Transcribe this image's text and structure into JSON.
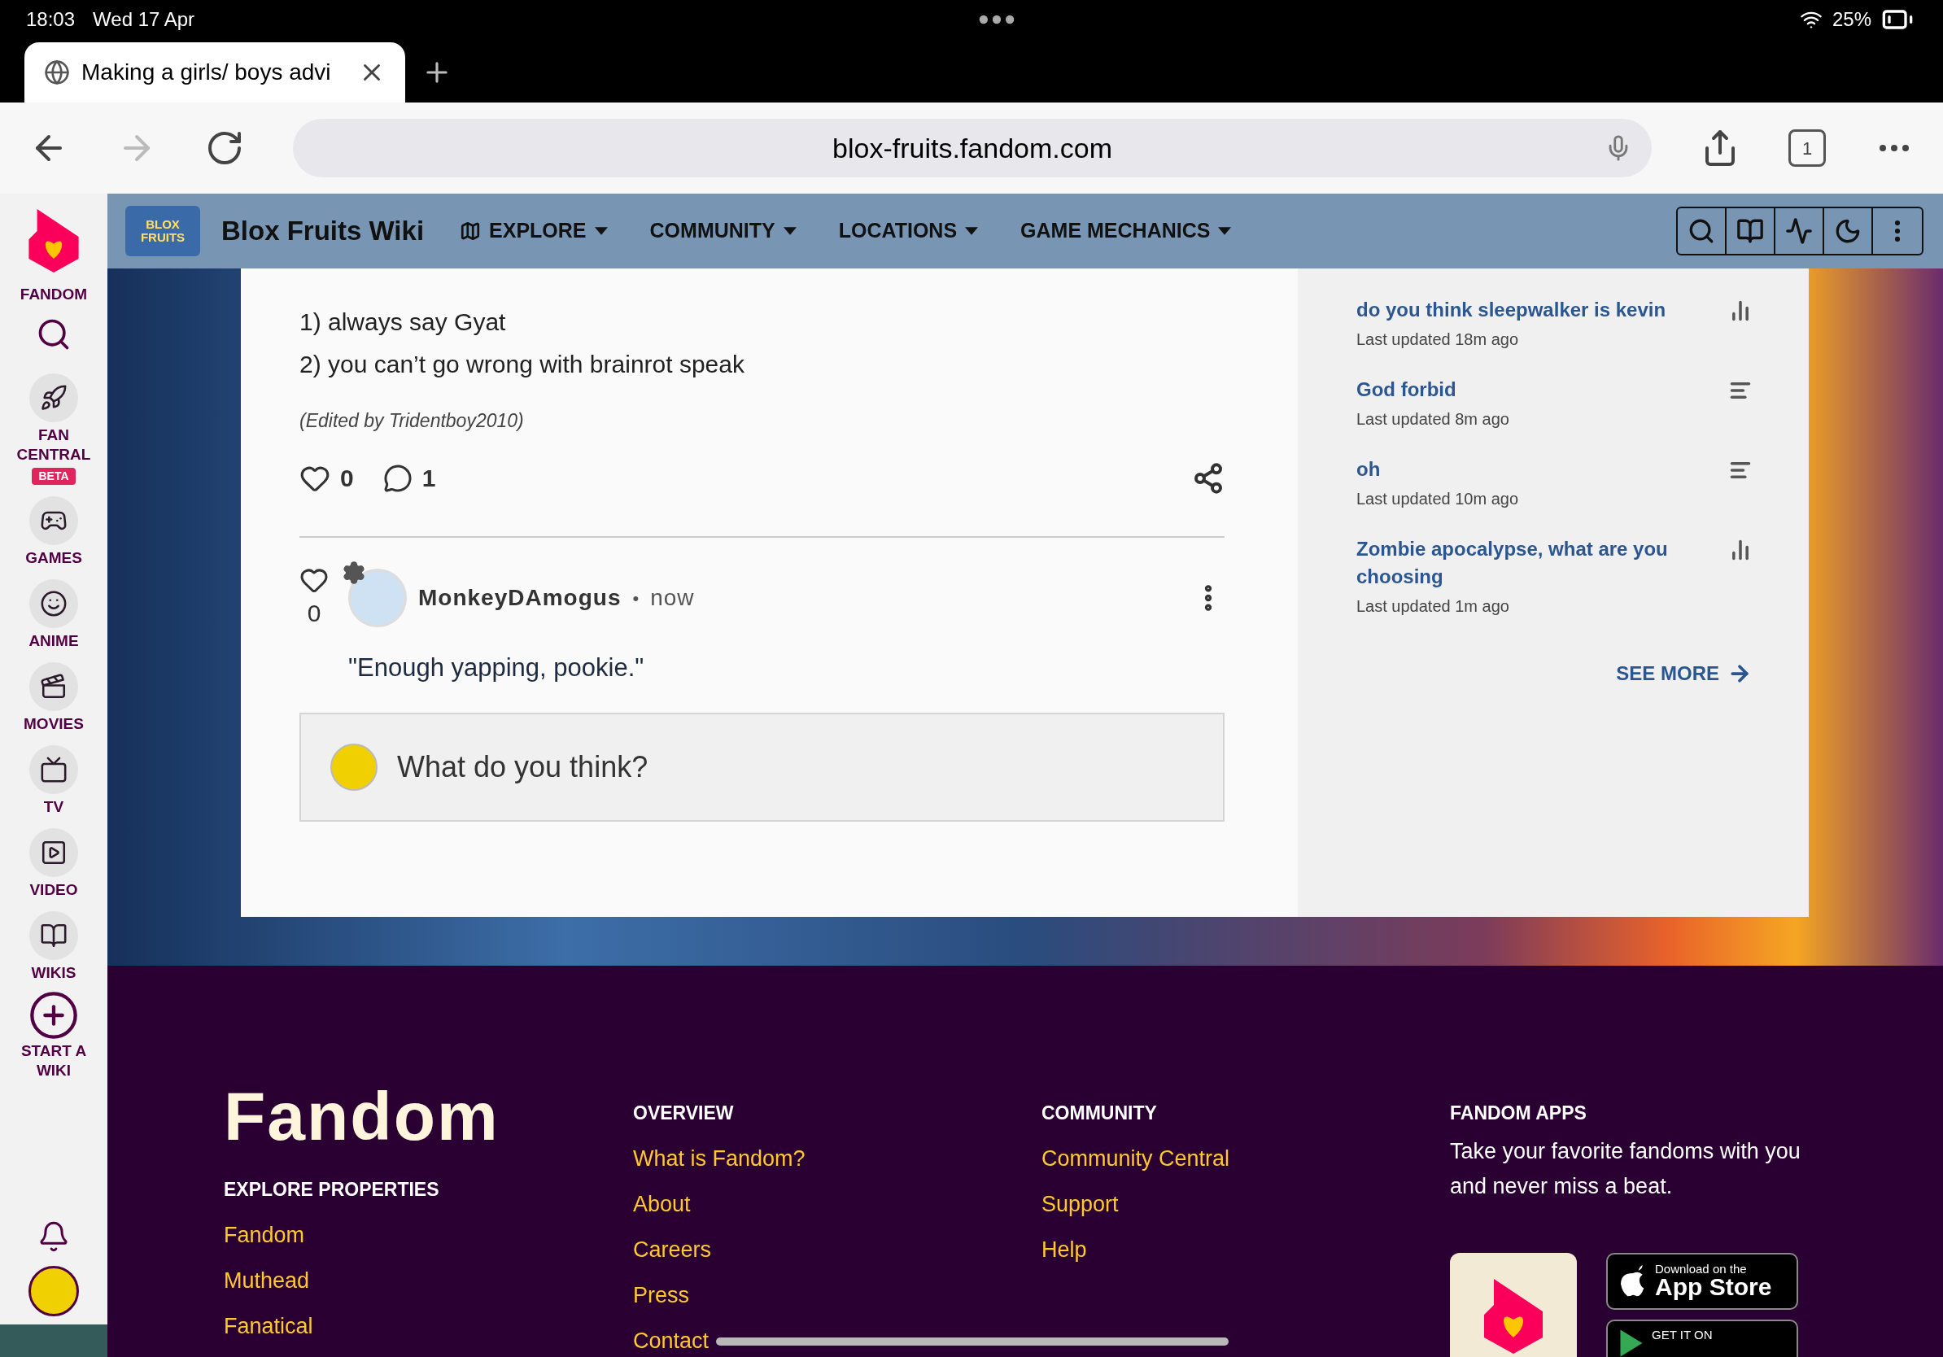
{
  "status_bar": {
    "time": "18:03",
    "date": "Wed 17 Apr",
    "battery": "25%"
  },
  "browser": {
    "tab_title": "Making a girls/ boys advi",
    "url": "blox-fruits.fandom.com",
    "tab_count": "1"
  },
  "sidebar": {
    "brand": "FANDOM",
    "items": [
      {
        "kind": "search"
      },
      {
        "kind": "rocket",
        "label": "FAN CENTRAL",
        "badge": "BETA"
      },
      {
        "kind": "gamepad",
        "label": "GAMES"
      },
      {
        "kind": "anime",
        "label": "ANIME"
      },
      {
        "kind": "movies",
        "label": "MOVIES"
      },
      {
        "kind": "tv",
        "label": "TV"
      },
      {
        "kind": "video",
        "label": "VIDEO"
      },
      {
        "kind": "wikis",
        "label": "WIKIS"
      },
      {
        "kind": "start",
        "label": "START A WIKI"
      }
    ]
  },
  "wiki_header": {
    "logo": "BLOX FRUITS",
    "title": "Blox Fruits Wiki",
    "nav": [
      {
        "kind": "explore",
        "label": "EXPLORE"
      },
      {
        "kind": "menu",
        "label": "COMMUNITY"
      },
      {
        "kind": "menu",
        "label": "LOCATIONS"
      },
      {
        "kind": "menu",
        "label": "GAME MECHANICS"
      }
    ]
  },
  "post": {
    "lines": [
      "1) always say Gyat",
      "2) you can’t go wrong with brainrot speak"
    ],
    "edited": "(Edited by Tridentboy2010)",
    "likes": "0",
    "comments": "1",
    "reply": {
      "likes": "0",
      "author": "MonkeyDAmogus",
      "separator": "•",
      "time": "now",
      "text": "\"Enough yapping, pookie.\""
    },
    "reply_box": {
      "placeholder": "What do you think?"
    }
  },
  "discussions": {
    "items": [
      {
        "kind": "poll",
        "title": "do you think sleepwalker is kevin",
        "updated": "Last updated 18m ago"
      },
      {
        "kind": "text",
        "title": "God forbid",
        "updated": "Last updated 8m ago"
      },
      {
        "kind": "text",
        "title": "oh",
        "updated": "Last updated 10m ago"
      },
      {
        "kind": "poll",
        "title": "Zombie apocalypse, what are you choosing",
        "updated": "Last updated 1m ago"
      }
    ],
    "see_more": "SEE MORE"
  },
  "footer": {
    "logo": "Fandom",
    "columns": [
      {
        "heading": "EXPLORE PROPERTIES",
        "links": [
          "Fandom",
          "Muthead",
          "Fanatical"
        ]
      },
      {
        "heading": "OVERVIEW",
        "links": [
          "What is Fandom?",
          "About",
          "Careers",
          "Press",
          "Contact"
        ]
      },
      {
        "heading": "COMMUNITY",
        "links": [
          "Community Central",
          "Support",
          "Help"
        ]
      }
    ],
    "apps": {
      "heading": "FANDOM APPS",
      "text": "Take your favorite fandoms with you and never miss a beat.",
      "app_store_small": "Download on the",
      "app_store": "App Store",
      "google_play_small": "GET IT ON"
    }
  }
}
